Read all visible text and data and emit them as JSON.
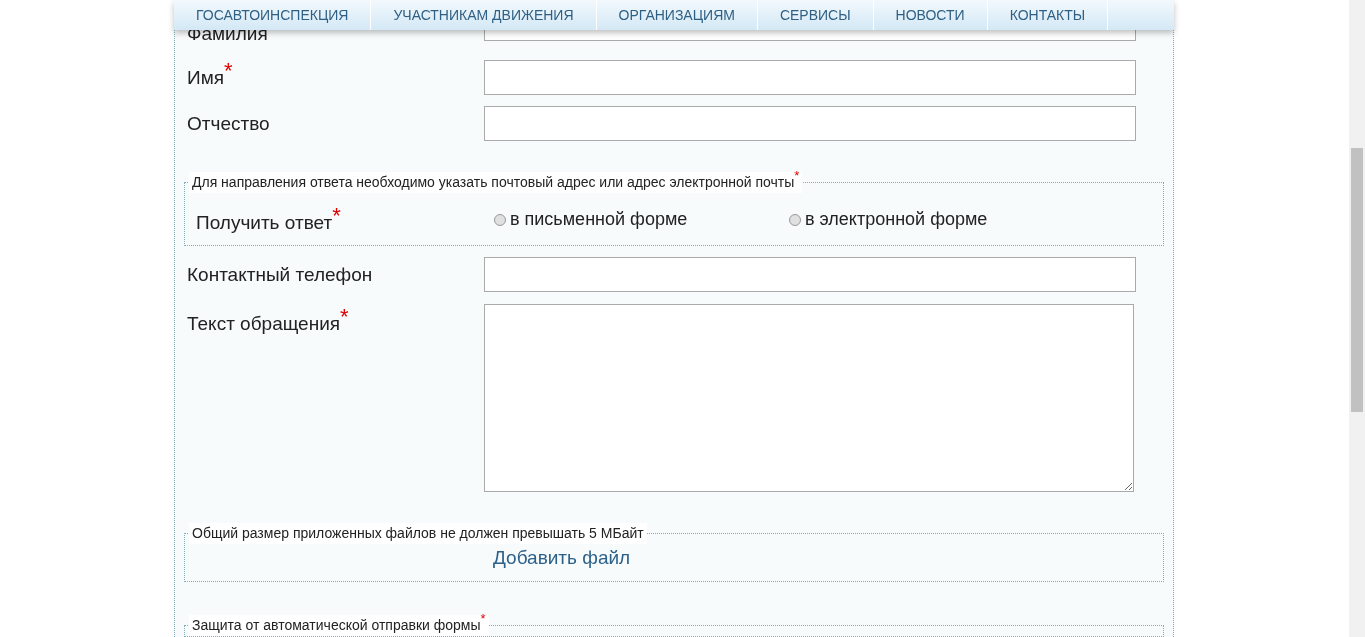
{
  "nav": {
    "items": [
      {
        "label": "ГОСАВТОИНСПЕКЦИЯ"
      },
      {
        "label": "УЧАСТНИКАМ ДВИЖЕНИЯ"
      },
      {
        "label": "ОРГАНИЗАЦИЯМ"
      },
      {
        "label": "СЕРВИСЫ"
      },
      {
        "label": "НОВОСТИ"
      },
      {
        "label": "КОНТАКТЫ"
      }
    ]
  },
  "form": [
    {
      "kind": "text",
      "label": "Фамилия"
    },
    {
      "kind": "text",
      "label": "Имя",
      "required_mark": "*"
    },
    {
      "kind": "text",
      "label": "Отчество"
    },
    {
      "kind": "choice",
      "legend": "Для направления ответа необходимо указать почтовый адрес или адрес электронной почты",
      "legend_mark": "*",
      "label": "Получить ответ",
      "required_mark": "*",
      "options": [
        {
          "label": "в письменной форме",
          "selected": false
        },
        {
          "label": "в электронной форме",
          "selected": false
        }
      ]
    },
    {
      "kind": "text",
      "label": "Контактный телефон"
    },
    {
      "kind": "textarea",
      "label": "Текст обращения",
      "required_mark": "*"
    },
    {
      "kind": "files",
      "legend": "Общий размер приложенных файлов не должен превышать 5 МБайт",
      "link": "Добавить файл"
    },
    {
      "kind": "captcha",
      "legend": "Защита от автоматической отправки формы",
      "legend_mark": "*"
    }
  ]
}
